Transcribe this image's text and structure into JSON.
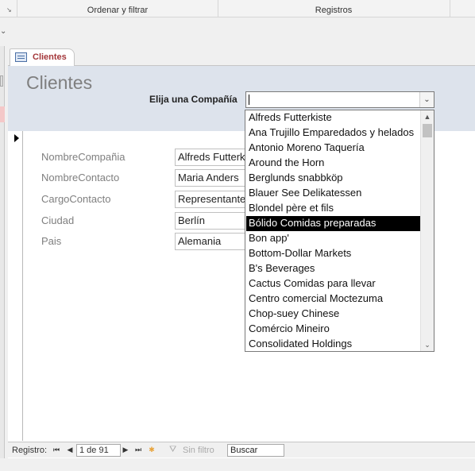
{
  "ribbon": {
    "groups": [
      "Ordenar y filtrar",
      "Registros"
    ]
  },
  "tab": {
    "label": "Clientes"
  },
  "form": {
    "title": "Clientes",
    "combo_label": "Elija una Compañía"
  },
  "fields": [
    {
      "label": "NombreCompañia",
      "value": "Alfreds Futterkiste"
    },
    {
      "label": "NombreContacto",
      "value": "Maria Anders"
    },
    {
      "label": "CargoContacto",
      "value": "Representante de ventas"
    },
    {
      "label": "Ciudad",
      "value": "Berlín"
    },
    {
      "label": "Pais",
      "value": "Alemania"
    }
  ],
  "dropdown": {
    "items": [
      "Alfreds Futterkiste",
      "Ana Trujillo Emparedados y helados",
      "Antonio Moreno Taquería",
      "Around the Horn",
      "Berglunds snabbköp",
      "Blauer See Delikatessen",
      "Blondel père et fils",
      "Bólido Comidas preparadas",
      "Bon app'",
      "Bottom-Dollar Markets",
      "B's Beverages",
      "Cactus Comidas para llevar",
      "Centro comercial Moctezuma",
      "Chop-suey Chinese",
      "Comércio Mineiro",
      "Consolidated Holdings"
    ],
    "selected_index": 7
  },
  "navbar": {
    "label": "Registro:",
    "record": "1 de 91",
    "filter": "Sin filtro",
    "search": "Buscar"
  },
  "icons": {
    "first": "first-record-icon",
    "prev": "previous-record-icon",
    "next": "next-record-icon",
    "last": "last-record-icon",
    "new": "new-record-icon",
    "filter": "filter-icon"
  }
}
